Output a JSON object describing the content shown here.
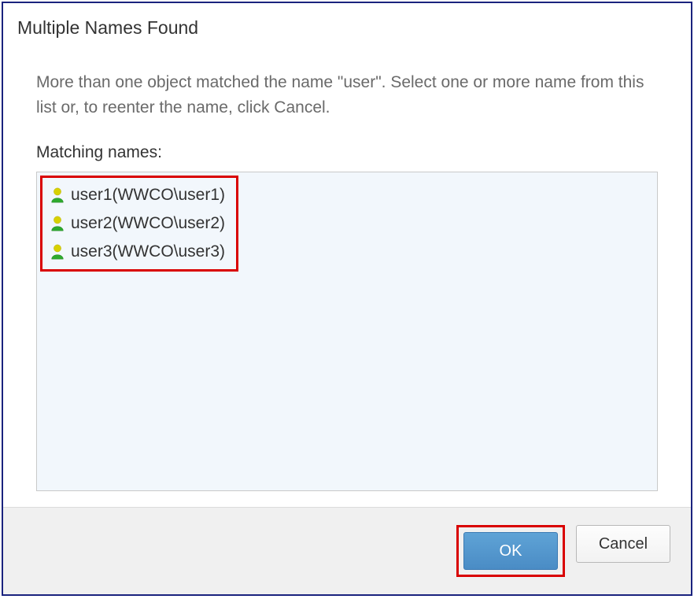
{
  "dialog": {
    "title": "Multiple Names Found",
    "instructions": "More than one object matched the name \"user\". Select one or more name from this list or, to reenter the name, click Cancel.",
    "list_label": "Matching names:",
    "items": [
      {
        "label": "user1(WWCO\\user1)"
      },
      {
        "label": "user2(WWCO\\user2)"
      },
      {
        "label": "user3(WWCO\\user3)"
      }
    ],
    "buttons": {
      "ok": "OK",
      "cancel": "Cancel"
    }
  }
}
